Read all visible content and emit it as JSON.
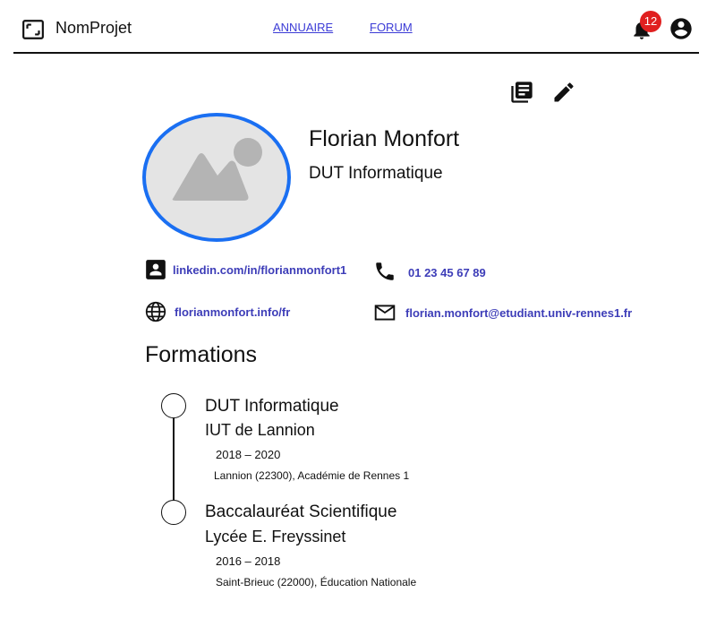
{
  "header": {
    "brand": "NomProjet",
    "nav": [
      {
        "label": "ANNUAIRE"
      },
      {
        "label": "FORUM"
      }
    ],
    "notifications_count": "12"
  },
  "profile": {
    "name": "Florian Monfort",
    "subtitle": "DUT Informatique",
    "accent_color": "#1a6ff2"
  },
  "contacts": {
    "linkedin": "linkedin.com/in/florianmonfort1",
    "phone": "01 23 45 67 89",
    "website": "florianmonfort.info/fr",
    "email": "florian.monfort@etudiant.univ-rennes1.fr",
    "link_color": "#3d3db8"
  },
  "formations": {
    "title": "Formations",
    "items": [
      {
        "degree": "DUT Informatique",
        "school": "IUT de Lannion",
        "years": "2018 – 2020",
        "place": "Lannion (22300), Académie de Rennes 1"
      },
      {
        "degree": "Baccalauréat Scientifique",
        "school": "Lycée E. Freyssinet",
        "years": "2016 – 2018",
        "place": "Saint-Brieuc (22000), Éducation Nationale"
      }
    ]
  },
  "icons": {
    "logo": "fullscreen-frame-icon",
    "notifications": "bell-icon",
    "account": "account-circle-icon",
    "library": "library-books-icon",
    "edit": "pencil-icon",
    "avatar_placeholder": "image-placeholder-icon",
    "linkedin": "contact-card-icon",
    "phone": "phone-icon",
    "website": "globe-icon",
    "email": "mail-icon"
  }
}
